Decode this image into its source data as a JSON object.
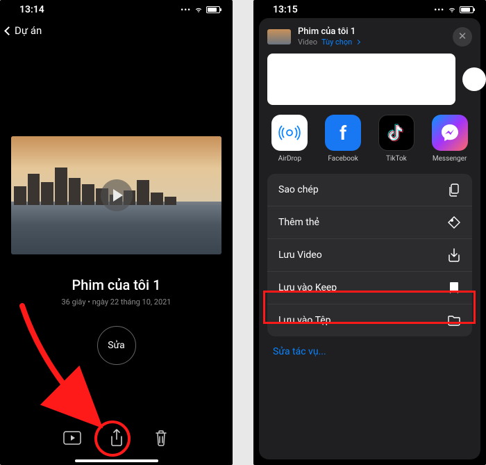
{
  "left": {
    "time": "13:14",
    "back_label": "Dự án",
    "project_title": "Phim của tôi 1",
    "project_meta": "36 giây • ngày 22 tháng 10, 2021",
    "edit_label": "Sửa"
  },
  "right": {
    "time": "13:15",
    "sheet": {
      "title": "Phim của tôi 1",
      "type_label": "Video",
      "options_label": "Tùy chọn"
    },
    "apps": [
      {
        "label": "AirDrop"
      },
      {
        "label": "Facebook"
      },
      {
        "label": "TikTok"
      },
      {
        "label": "Messenger"
      }
    ],
    "actions": [
      {
        "label": "Sao chép",
        "icon": "copy"
      },
      {
        "label": "Thêm thẻ",
        "icon": "tag"
      },
      {
        "label": "Lưu Video",
        "icon": "save-down",
        "highlighted": true
      },
      {
        "label": "Lưu vào Keep",
        "icon": "bookmark"
      },
      {
        "label": "Lưu vào Tệp",
        "icon": "folder"
      }
    ],
    "edit_actions_label": "Sửa tác vụ..."
  },
  "annotation": {
    "arrow_color": "#ff1a1a"
  }
}
